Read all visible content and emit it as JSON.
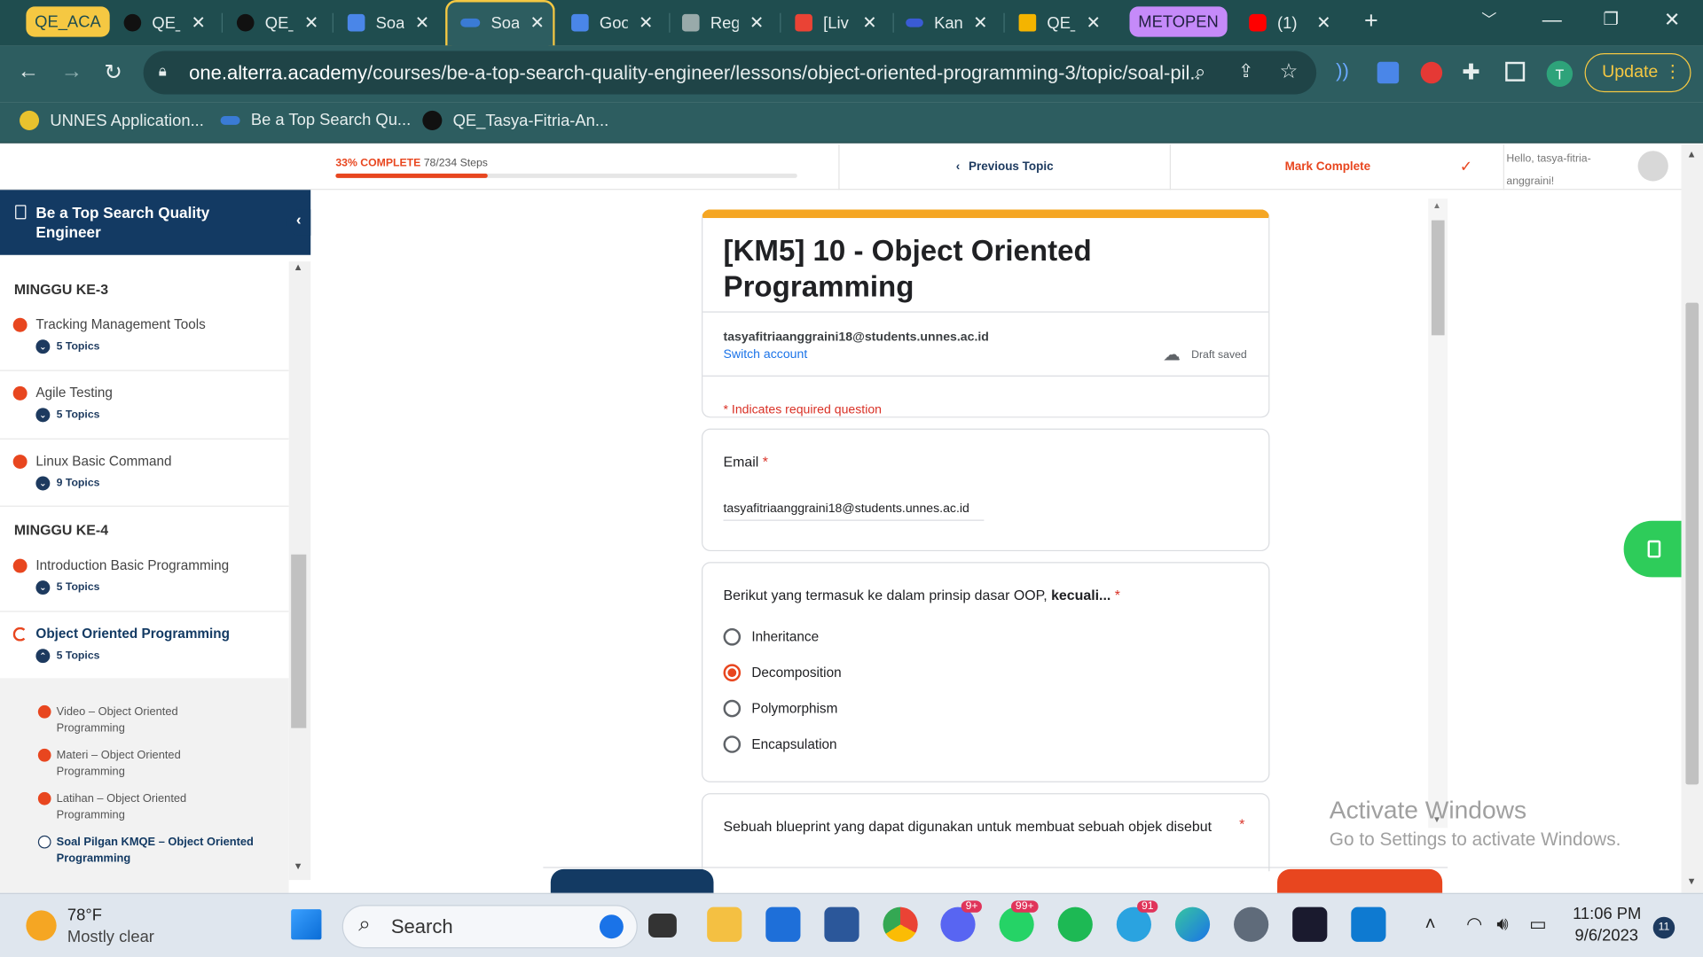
{
  "browser": {
    "tabs": [
      {
        "label": "QE_ACA",
        "kind": "group-yellow"
      },
      {
        "label": "QE_"
      },
      {
        "label": "QE_"
      },
      {
        "label": "Soa"
      },
      {
        "label": "Soa",
        "active": true
      },
      {
        "label": "Goo"
      },
      {
        "label": "Reg"
      },
      {
        "label": "[Liv"
      },
      {
        "label": "Kan"
      },
      {
        "label": "QE_"
      },
      {
        "label": "METOPEN",
        "kind": "group-purple"
      },
      {
        "label": "(1)"
      }
    ],
    "url_host": "one.alterra.academy",
    "url_path": "/courses/be-a-top-search-quality-engineer/lessons/object-oriented-programming-3/topic/soal-pil...",
    "profile_initial": "T",
    "update_label": "Update",
    "bookmarks": [
      {
        "label": "UNNES Application..."
      },
      {
        "label": "Be a Top Search Qu..."
      },
      {
        "label": "QE_Tasya-Fitria-An..."
      }
    ]
  },
  "course": {
    "progress_label": "33% COMPLETE",
    "progress_steps": "78/234 Steps",
    "progress_fraction": 0.33,
    "prev_topic": "Previous Topic",
    "mark_complete": "Mark Complete",
    "hello_line1": "Hello, tasya-fitria-",
    "hello_line2": "anggraini!",
    "title": "Be a Top Search Quality Engineer",
    "weeks": [
      {
        "label": "MINGGU KE-3"
      },
      {
        "label": "MINGGU KE-4"
      }
    ],
    "lessons": [
      {
        "title": "Tracking Management Tools",
        "topics": "5 Topics"
      },
      {
        "title": "Agile Testing",
        "topics": "5 Topics"
      },
      {
        "title": "Linux Basic Command",
        "topics": "9 Topics"
      },
      {
        "title": "Introduction Basic Programming",
        "topics": "5 Topics"
      },
      {
        "title": "Object Oriented Programming",
        "topics": "5 Topics"
      }
    ],
    "subtopics": [
      {
        "line1": "Video – Object Oriented",
        "line2": "Programming"
      },
      {
        "line1": "Materi – Object Oriented",
        "line2": "Programming"
      },
      {
        "line1": "Latihan – Object Oriented",
        "line2": "Programming"
      },
      {
        "line1": "Soal Pilgan KMQE – Object Oriented",
        "line2": "Programming"
      }
    ]
  },
  "form": {
    "title_line1": "[KM5] 10 - Object Oriented",
    "title_line2": "Programming",
    "account": "tasyafitriaanggraini18@students.unnes.ac.id",
    "switch_account": "Switch account",
    "draft_status": "Draft saved",
    "required_note": "* Indicates required question",
    "email_label": "Email",
    "email_value": "tasyafitriaanggraini18@students.unnes.ac.id",
    "q1_text": "Berikut yang termasuk ke dalam prinsip dasar OOP, ",
    "q1_bold": "kecuali...",
    "q1_options": [
      "Inheritance",
      "Decomposition",
      "Polymorphism",
      "Encapsulation"
    ],
    "q1_selected": "Decomposition",
    "q2_text": "Sebuah blueprint yang dapat digunakan untuk membuat sebuah objek disebut",
    "required_star": "*"
  },
  "overlay": {
    "activate_title": "Activate Windows",
    "activate_sub": "Go to Settings to activate Windows."
  },
  "taskbar": {
    "weather_temp": "78°F",
    "weather_desc": "Mostly clear",
    "search_placeholder": "Search",
    "discord_badge": "9+",
    "whatsapp_badge": "99+",
    "telegram_badge": "91",
    "time": "11:06 PM",
    "date": "9/6/2023",
    "notifications": "11"
  },
  "colors": {
    "accent": "#e8461f",
    "navy": "#133a63",
    "chrome_bg": "#2d5d60",
    "form_header": "#f5a623"
  }
}
